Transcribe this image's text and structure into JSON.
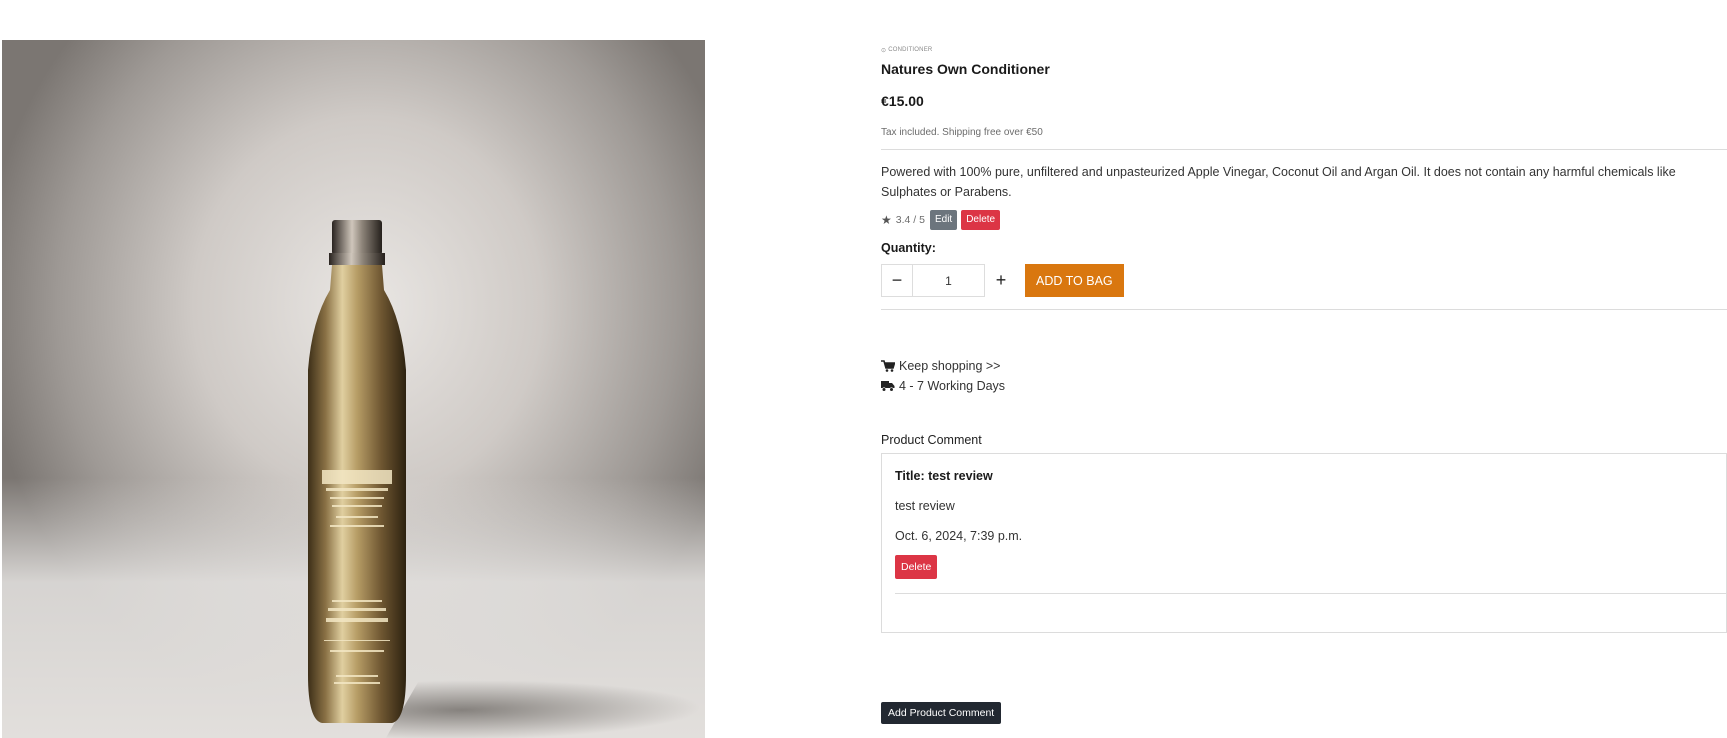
{
  "product": {
    "category": "CONDITIONER",
    "name": "Natures Own Conditioner",
    "price": "€15.00",
    "tax_note": "Tax included. Shipping free over €50",
    "description": "Powered with 100% pure, unfiltered and unpasteurized Apple Vinegar, Coconut Oil and Argan Oil. It does not contain any harmful chemicals like Sulphates or Parabens.",
    "rating": "3.4 / 5",
    "image_label": "LE.ONER"
  },
  "admin": {
    "edit_label": "Edit",
    "delete_label": "Delete"
  },
  "quantity": {
    "label": "Quantity:",
    "value": "1",
    "minus": "−",
    "plus": "+"
  },
  "bag": {
    "add_label": "ADD TO BAG"
  },
  "links": {
    "keep_shopping": "Keep shopping >>",
    "delivery": "4 - 7 Working Days"
  },
  "comments": {
    "heading": "Product Comment",
    "items": [
      {
        "title": "Title: test review",
        "body": "test review",
        "date": "Oct. 6, 2024, 7:39 p.m.",
        "delete_label": "Delete"
      }
    ],
    "add_label": "Add Product Comment"
  },
  "colors": {
    "accent": "#d9770f",
    "danger": "#dc3545",
    "secondary": "#6c757d",
    "dark": "#222831"
  }
}
